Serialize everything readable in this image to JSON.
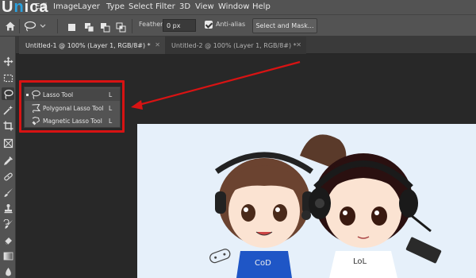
{
  "watermark": {
    "logo_text_1": "U",
    "logo_text_accent": "n",
    "logo_text_2": "ica"
  },
  "menubar": {
    "items": [
      {
        "label": "Edi"
      },
      {
        "label": "Image"
      },
      {
        "label": "Layer"
      },
      {
        "label": "Type"
      },
      {
        "label": "Select"
      },
      {
        "label": "Filter"
      },
      {
        "label": "3D"
      },
      {
        "label": "View"
      },
      {
        "label": "Window"
      },
      {
        "label": "Help"
      }
    ]
  },
  "options_bar": {
    "home_icon": "home-icon",
    "tool_icon": "lasso-icon",
    "feather_label": "Feather:",
    "feather_value": "0 px",
    "antialias_label": "Anti-alias",
    "antialias_checked": true,
    "select_and_mask_label": "Select and Mask..."
  },
  "tabs": [
    {
      "label": "Untitled-1 @ 100% (Layer 1, RGB/8#) *",
      "active": true
    },
    {
      "label": "Untitled-2 @ 100% (Layer 1, RGB/8#) *",
      "active": false
    }
  ],
  "toolbar": {
    "tools": [
      "move-icon",
      "marquee-icon",
      "lasso-icon",
      "magic-wand-icon",
      "crop-icon",
      "frame-icon",
      "eyedropper-icon",
      "healing-brush-icon",
      "brush-icon",
      "clone-stamp-icon",
      "history-brush-icon",
      "eraser-icon",
      "gradient-icon",
      "blur-icon"
    ],
    "selected": "lasso-icon"
  },
  "flyout": {
    "items": [
      {
        "label": "Lasso Tool",
        "shortcut": "L",
        "icon": "lasso-icon",
        "current": true
      },
      {
        "label": "Polygonal Lasso Tool",
        "shortcut": "L",
        "icon": "polygonal-lasso-icon",
        "current": false
      },
      {
        "label": "Magnetic Lasso Tool",
        "shortcut": "L",
        "icon": "magnetic-lasso-icon",
        "current": false
      }
    ]
  },
  "colors": {
    "highlight": "#d81313",
    "panel": "#535353",
    "workspace": "#282828",
    "accent_logo": "#2aa1de"
  },
  "canvas": {
    "shirt_left_text": "CoD",
    "shirt_right_text": "LoL"
  }
}
